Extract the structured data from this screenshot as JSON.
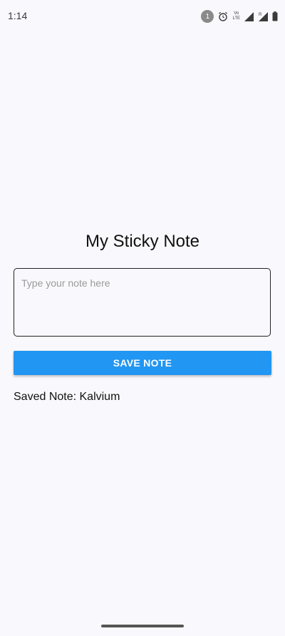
{
  "status_bar": {
    "time": "1:14",
    "notification_count": "1",
    "volte_top": "Vo",
    "volte_sub": "LTE",
    "network_r": "R"
  },
  "main": {
    "title": "My Sticky Note",
    "note_input": {
      "placeholder": "Type your note here",
      "value": ""
    },
    "save_button_label": "SAVE NOTE",
    "saved_note_text": "Saved Note: Kalvium"
  },
  "colors": {
    "accent": "#2196f3",
    "background": "#f9f8fc"
  },
  "icons": [
    "notification-badge-icon",
    "alarm-icon",
    "volte-icon",
    "signal-icon",
    "roaming-signal-icon",
    "battery-icon"
  ]
}
